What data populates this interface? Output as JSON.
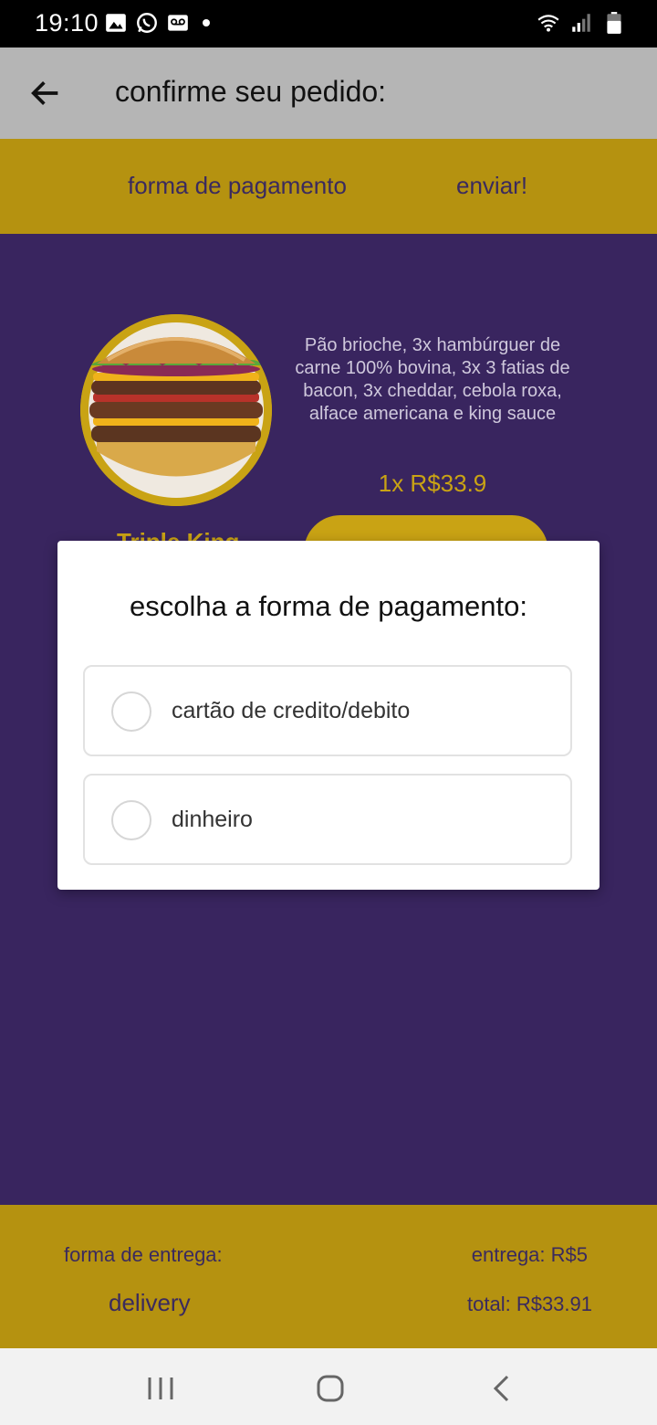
{
  "status_bar": {
    "time": "19:10",
    "left_icons": [
      "image-icon",
      "whatsapp-icon",
      "voicemail-icon",
      "dot-icon"
    ],
    "right_icons": [
      "wifi-icon",
      "signal-icon",
      "battery-icon"
    ]
  },
  "app_bar": {
    "back_icon": "arrow-left-icon",
    "title": "confirme seu pedido:"
  },
  "tabs": [
    {
      "label": "forma de pagamento"
    },
    {
      "label": "enviar!"
    }
  ],
  "product": {
    "name": "Triple King",
    "description": "Pão brioche, 3x hambúrguer de carne 100% bovina, 3x 3 fatias de bacon, 3x cheddar, cebola roxa, alface americana e king sauce",
    "price": "1x R$33.9"
  },
  "dialog": {
    "title": "escolha a forma de pagamento:",
    "options": [
      {
        "label": "cartão de credito/debito",
        "selected": false
      },
      {
        "label": "dinheiro",
        "selected": false
      }
    ]
  },
  "bottom_bar": {
    "delivery_label": "forma de entrega:",
    "delivery_value": "delivery",
    "fee_label": "entrega: R$5",
    "total_label": "total: R$33.91"
  },
  "colors": {
    "accent_gold": "#b59210",
    "purple": "#39255f",
    "app_bar": "#b5b5b5"
  }
}
